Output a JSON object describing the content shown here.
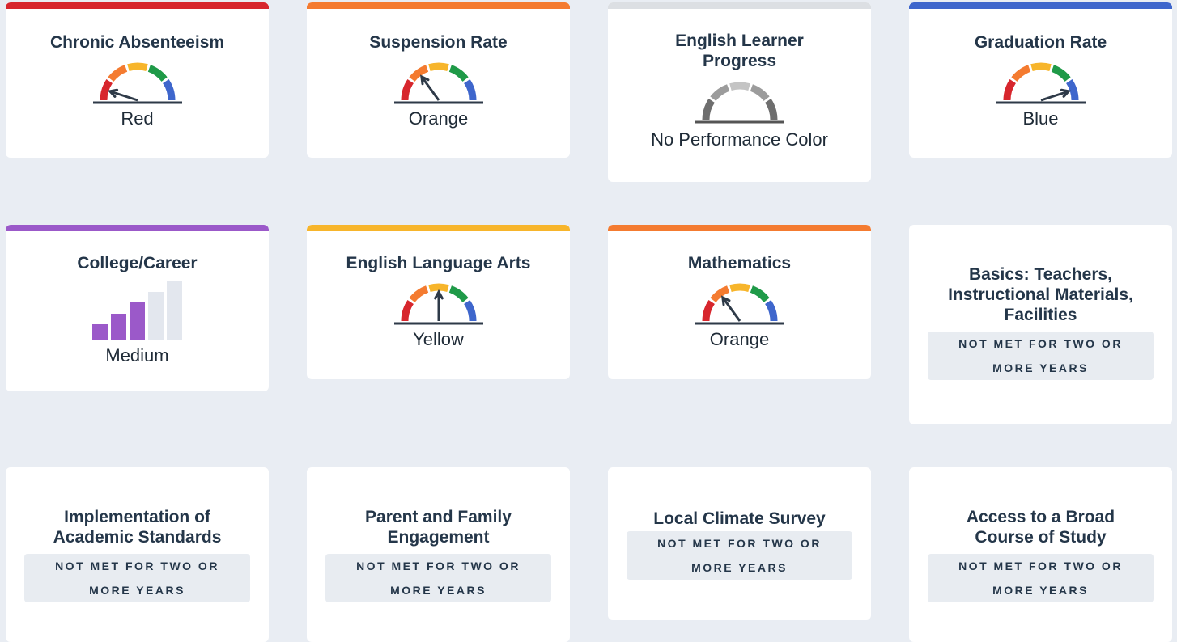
{
  "colors": {
    "red": "#d7262d",
    "orange": "#f47b30",
    "yellow": "#f7b52b",
    "green": "#1f9a48",
    "blue": "#3e66cc",
    "purple": "#9b59c9",
    "gray_bar": "#dcdfe3",
    "needle": "#2e3a48"
  },
  "row1": [
    {
      "title": "Chronic Absenteeism",
      "status": "Red",
      "level": 1
    },
    {
      "title": "Suspension Rate",
      "status": "Orange",
      "level": 2
    },
    {
      "title_line1": "English Learner",
      "title_line2": "Progress",
      "status": "No Performance Color"
    },
    {
      "title": "Graduation Rate",
      "status": "Blue",
      "level": 5
    }
  ],
  "row2": [
    {
      "title": "College/Career",
      "status": "Medium",
      "level": 3,
      "levels_total": 5
    },
    {
      "title": "English Language Arts",
      "status": "Yellow",
      "level": 3
    },
    {
      "title": "Mathematics",
      "status": "Orange",
      "level": 2
    },
    {
      "title_line1": "Basics: Teachers,",
      "title_line2": "Instructional Materials,",
      "title_line3": "Facilities",
      "badge_line1": "NOT MET FOR TWO OR",
      "badge_line2": "MORE YEARS"
    }
  ],
  "row3": [
    {
      "title_line1": "Implementation of",
      "title_line2": "Academic Standards",
      "badge_line1": "NOT MET FOR TWO OR",
      "badge_line2": "MORE YEARS"
    },
    {
      "title_line1": "Parent and Family",
      "title_line2": "Engagement",
      "badge_line1": "NOT MET FOR TWO OR",
      "badge_line2": "MORE YEARS"
    },
    {
      "title": "Local Climate Survey",
      "badge_line1": "NOT MET FOR TWO OR",
      "badge_line2": "MORE YEARS"
    },
    {
      "title_line1": "Access to a Broad",
      "title_line2": "Course of Study",
      "badge_line1": "NOT MET FOR TWO OR",
      "badge_line2": "MORE YEARS"
    }
  ]
}
